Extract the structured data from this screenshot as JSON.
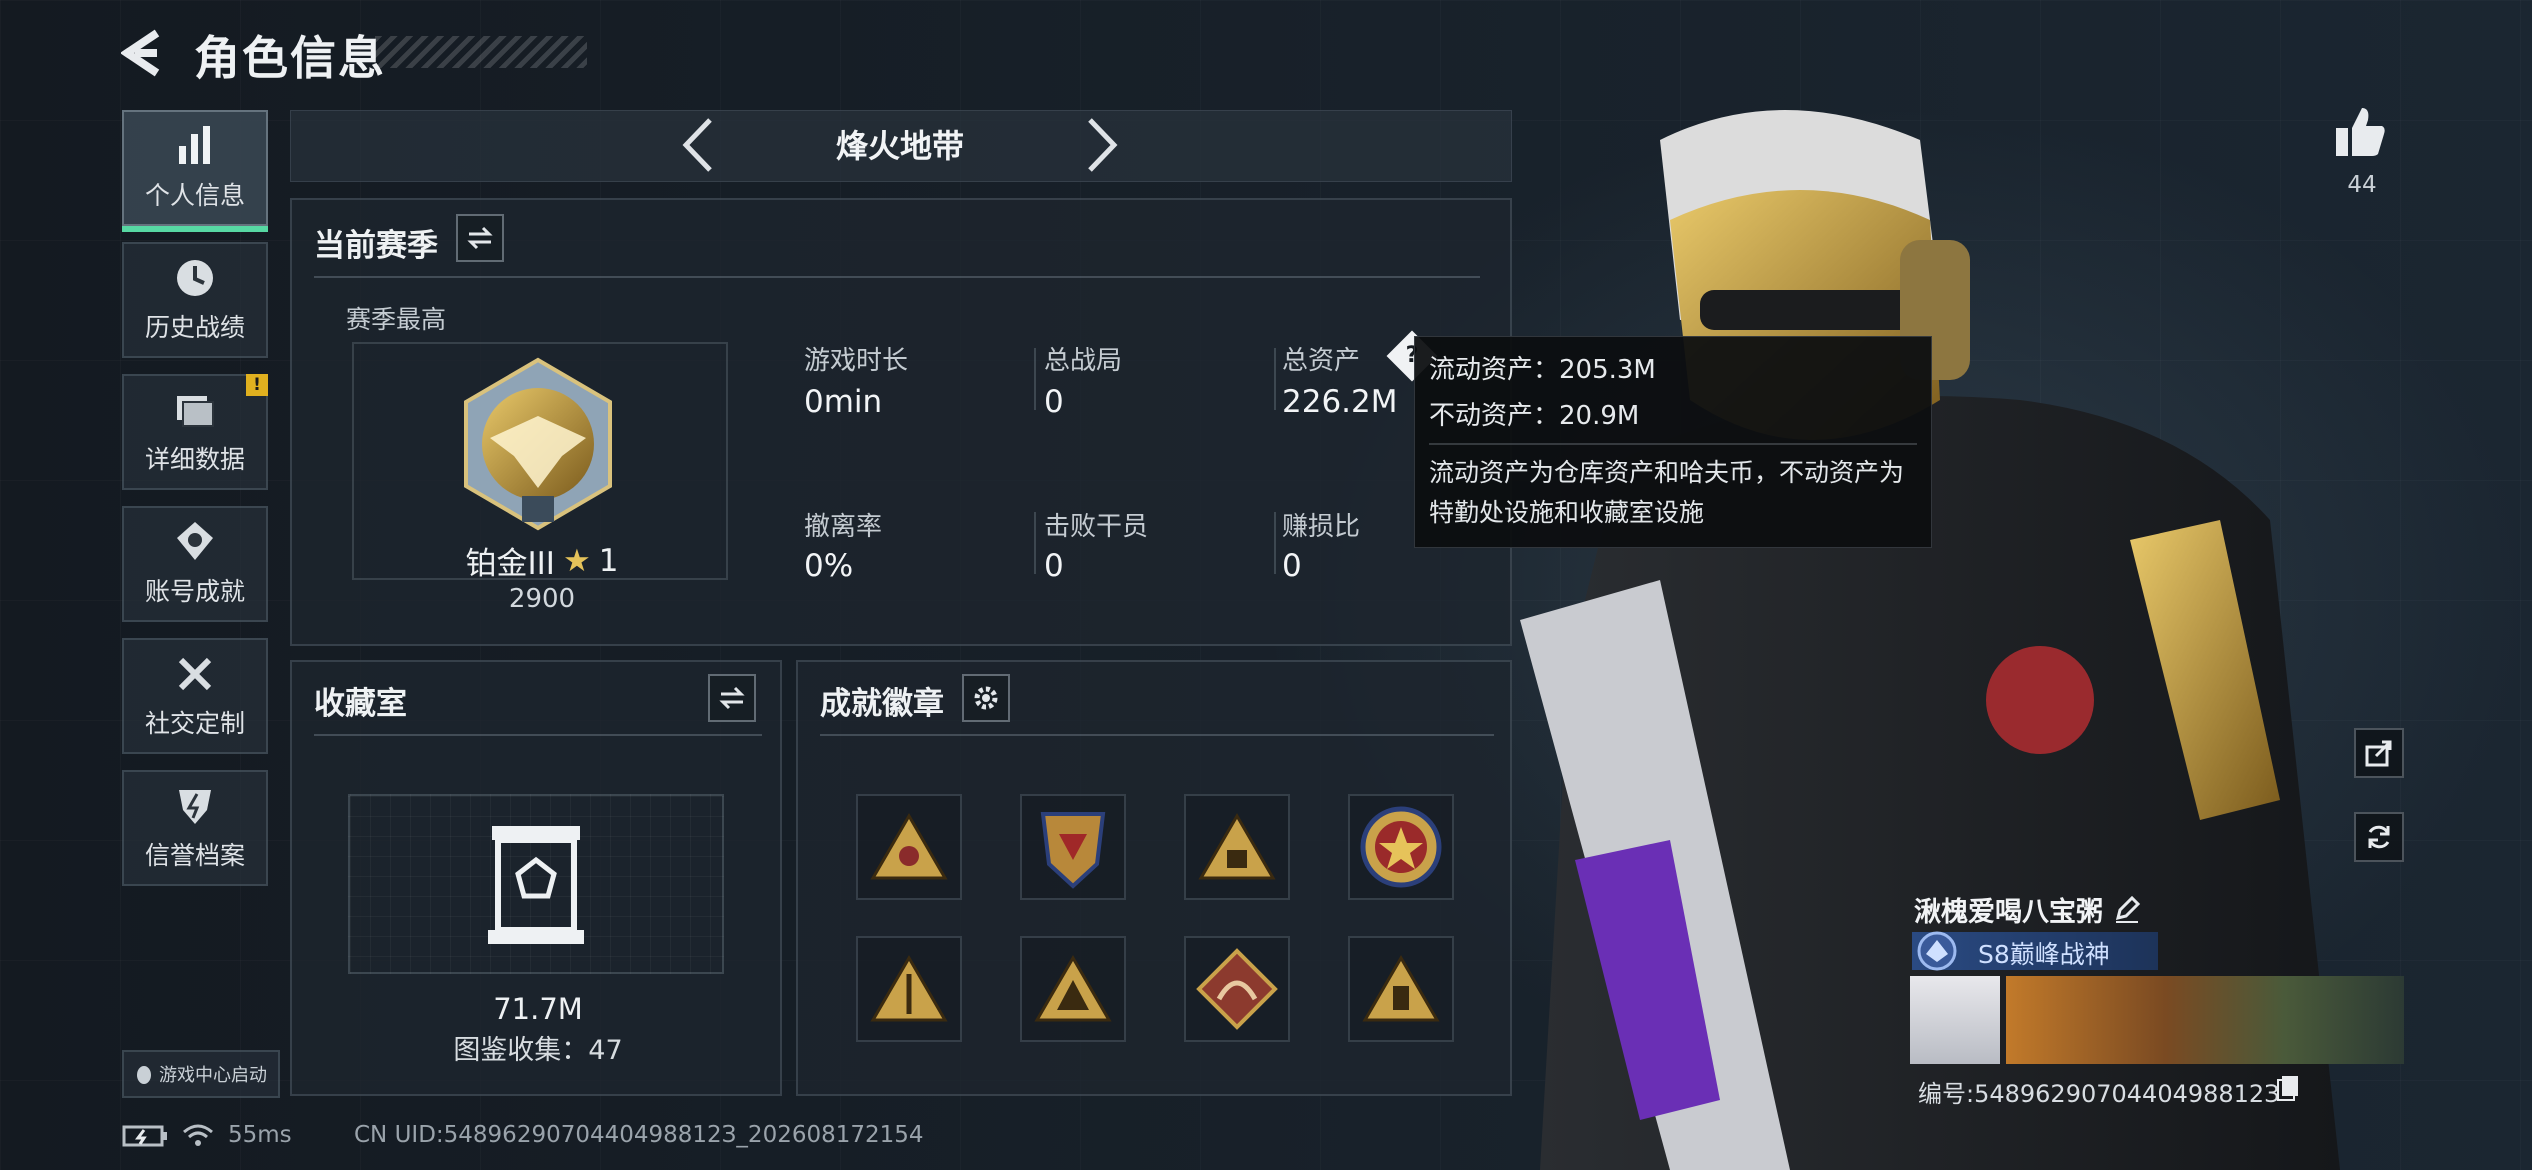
{
  "header": {
    "title": "角色信息"
  },
  "sidebar": {
    "items": [
      {
        "label": "个人信息",
        "icon": "bar-chart-icon",
        "active": true
      },
      {
        "label": "历史战绩",
        "icon": "clock-icon"
      },
      {
        "label": "详细数据",
        "icon": "folder-icon",
        "badge": "!"
      },
      {
        "label": "账号成就",
        "icon": "medal-icon"
      },
      {
        "label": "社交定制",
        "icon": "tools-icon"
      },
      {
        "label": "信誉档案",
        "icon": "shield-icon"
      }
    ],
    "game_center": "游戏中心启动"
  },
  "mode": {
    "title": "烽火地带"
  },
  "current_season": {
    "title": "当前赛季",
    "best_label": "赛季最高",
    "rank_name": "铂金III",
    "rank_stars": "1",
    "rank_score": "2900",
    "stats": [
      {
        "label": "游戏时长",
        "value": "0min"
      },
      {
        "label": "总战局",
        "value": "0"
      },
      {
        "label": "总资产",
        "value": "226.2M"
      },
      {
        "label": "撤离率",
        "value": "0%"
      },
      {
        "label": "击败干员",
        "value": "0"
      },
      {
        "label": "赚损比",
        "value": "0"
      }
    ]
  },
  "tooltip": {
    "liquid": "流动资产：205.3M",
    "fixed": "不动资产：20.9M",
    "desc": "流动资产为仓库资产和哈夫币，不动资产为特勤处设施和收藏室设施"
  },
  "collection": {
    "title": "收藏室",
    "value": "71.7M",
    "count": "图鉴收集：47"
  },
  "achievements": {
    "title": "成就徽章"
  },
  "status_bar": {
    "ping": "55ms",
    "uid": "CN UID:5489629070440498812З_202608172154"
  },
  "profile": {
    "name": "湫槐爱喝八宝粥",
    "rank": "S8巅峰战神",
    "id": "编号:5489629070440498812З"
  },
  "likes": {
    "count": "44"
  },
  "colors": {
    "accent": "#57d8a3",
    "gold": "#d4aa4c",
    "alert": "#e0b01f"
  }
}
